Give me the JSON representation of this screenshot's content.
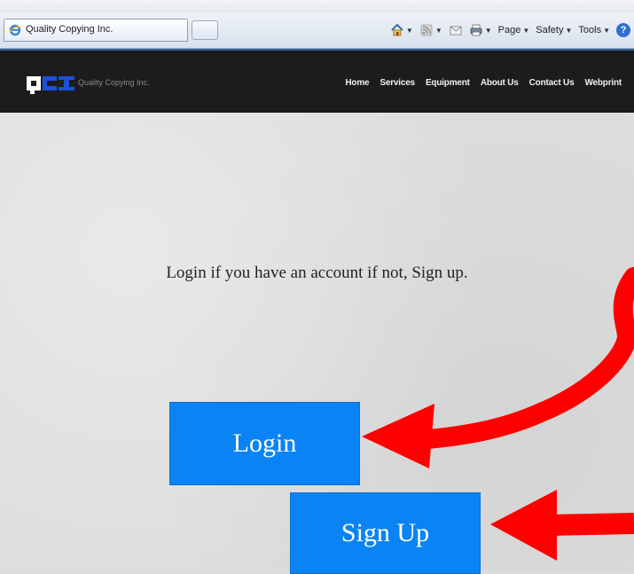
{
  "browser": {
    "tab_title": "Quality Copying Inc.",
    "commands": [
      {
        "label": "Page"
      },
      {
        "label": "Safety"
      },
      {
        "label": "Tools"
      }
    ],
    "help_label": "?"
  },
  "site": {
    "brand": "Quality Copying Inc.",
    "nav": [
      "Home",
      "Services",
      "Equipment",
      "About Us",
      "Contact Us",
      "Webprint"
    ]
  },
  "main": {
    "prompt": "Login if you have an account if not, Sign up.",
    "login_label": "Login",
    "signup_label": "Sign Up"
  },
  "colors": {
    "button_blue": "#0a84f5",
    "header_bg": "#1c1c1c",
    "annotation_red": "#ff0000"
  }
}
